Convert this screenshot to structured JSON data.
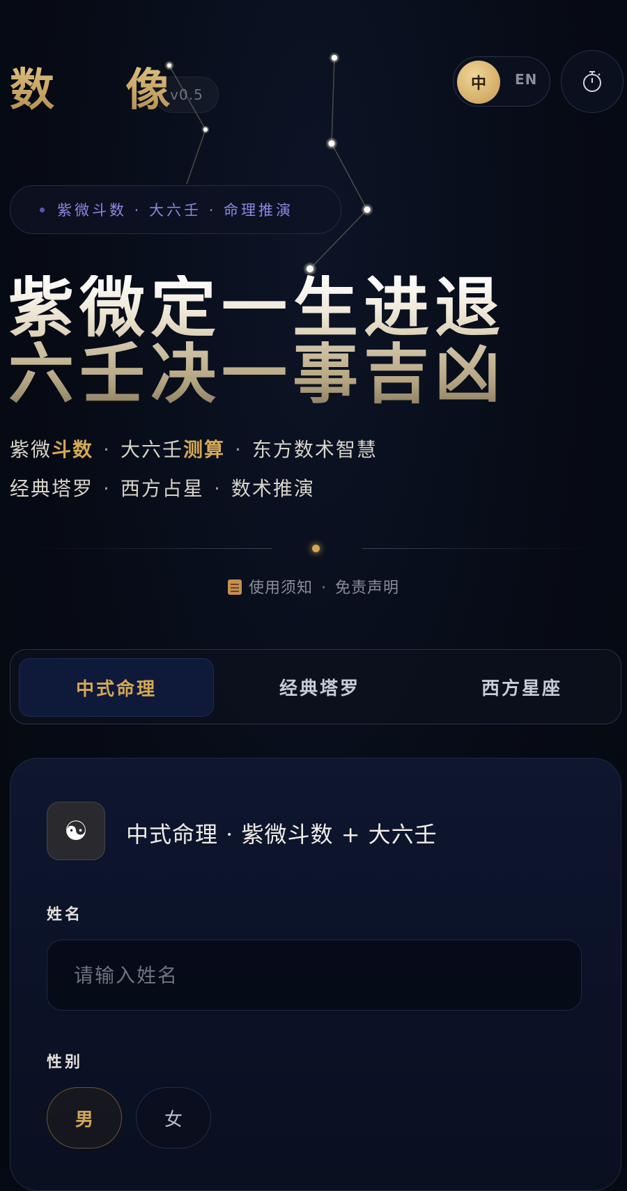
{
  "header": {
    "brand": "数 像",
    "version": "v0.5",
    "lang_zh": "中",
    "lang_en": "EN"
  },
  "tagline": "紫微斗数 · 大六壬 · 命理推演",
  "hero": {
    "line1": "紫微定一生进退",
    "line2": "六壬决一事吉凶"
  },
  "subtitle": {
    "line1": [
      {
        "text": "紫微",
        "accent": false
      },
      {
        "text": "斗数",
        "accent": true
      },
      {
        "text": "·",
        "sep": true
      },
      {
        "text": "大六壬",
        "accent": false
      },
      {
        "text": "测算",
        "accent": true
      },
      {
        "text": "·",
        "sep": true
      },
      {
        "text": "东方数术智慧",
        "accent": false
      }
    ],
    "line2": [
      {
        "text": "经典塔罗",
        "accent": false
      },
      {
        "text": "·",
        "sep": true
      },
      {
        "text": "西方占星",
        "accent": false
      },
      {
        "text": "·",
        "sep": true
      },
      {
        "text": "数术推演",
        "accent": false
      }
    ]
  },
  "notice": {
    "icon": "scroll-icon",
    "usage": "使用须知",
    "sep": "·",
    "disclaimer": "免责声明"
  },
  "tabs": [
    "中式命理",
    "经典塔罗",
    "西方星座"
  ],
  "card": {
    "icon": "yin-yang-icon",
    "icon_glyph": "☯",
    "title": "中式命理 · 紫微斗数 + 大六壬",
    "name_label": "姓名",
    "name_placeholder": "请输入姓名",
    "name_value": "",
    "gender_label": "性别",
    "gender_male": "男",
    "gender_female": "女",
    "gender_selected": "男"
  },
  "colors": {
    "accent_gold": "#d4a857",
    "tagline_purple": "#8c86e4",
    "background": "#070b16"
  }
}
